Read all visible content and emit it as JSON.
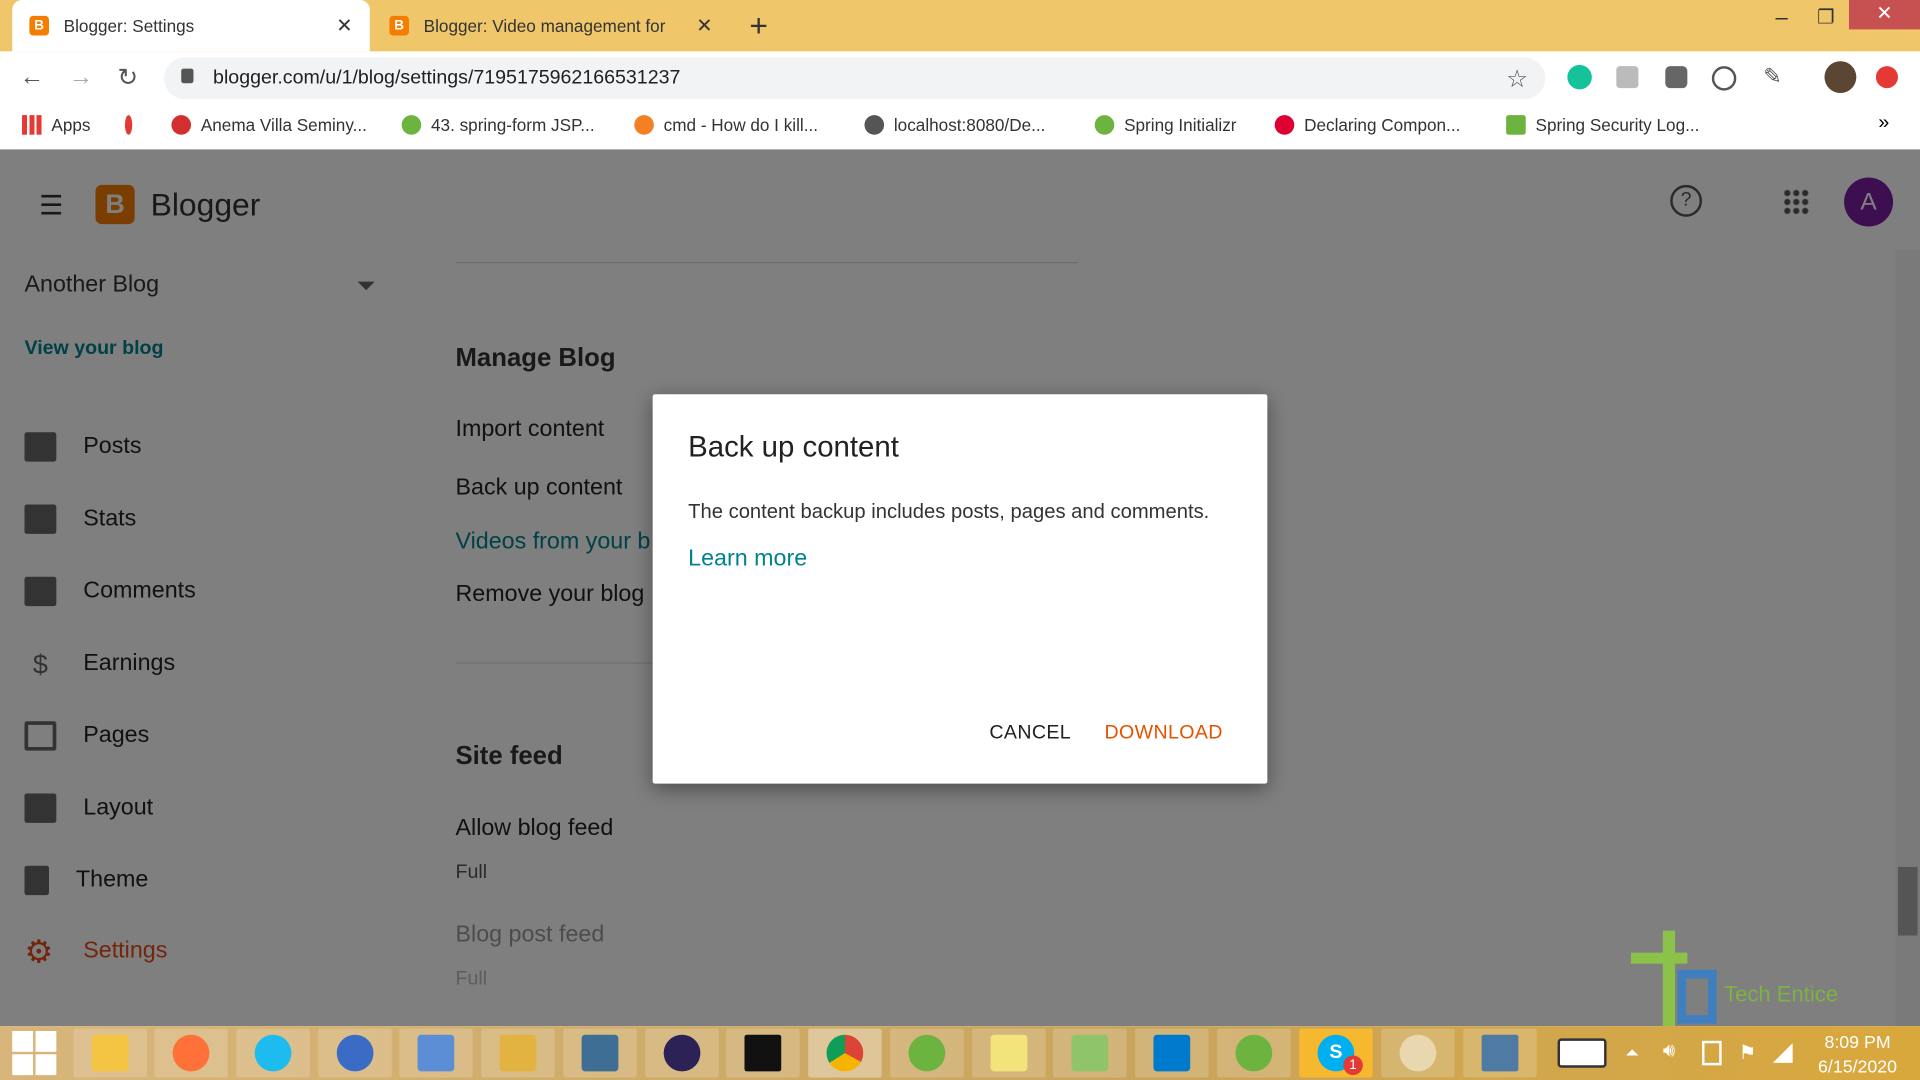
{
  "browser": {
    "tabs": [
      {
        "title": "Blogger: Settings",
        "active": true
      },
      {
        "title": "Blogger: Video management for",
        "active": false
      }
    ],
    "new_tab": "+",
    "url": "blogger.com/u/1/blog/settings/7195175962166531237",
    "bookmarks": [
      "Apps",
      "Anema Villa Seminy...",
      "43. spring-form JSP...",
      "cmd - How do I kill...",
      "localhost:8080/De...",
      "Spring Initializr",
      "Declaring Compon...",
      "Spring Security Log..."
    ],
    "more": "»"
  },
  "app": {
    "name": "Blogger",
    "avatar": "A",
    "help": "?"
  },
  "sidebar": {
    "blog_name": "Another Blog",
    "view_blog": "View your blog",
    "items": [
      {
        "label": "Posts",
        "icon": "posts-icon"
      },
      {
        "label": "Stats",
        "icon": "stats-icon"
      },
      {
        "label": "Comments",
        "icon": "comments-icon"
      },
      {
        "label": "Earnings",
        "icon": "dollar-icon"
      },
      {
        "label": "Pages",
        "icon": "pages-icon"
      },
      {
        "label": "Layout",
        "icon": "layout-icon"
      },
      {
        "label": "Theme",
        "icon": "theme-icon"
      },
      {
        "label": "Settings",
        "icon": "gear-icon",
        "active": true
      }
    ]
  },
  "main": {
    "manage_heading": "Manage Blog",
    "import": "Import content",
    "backup": "Back up content",
    "videos": "Videos from your b",
    "remove": "Remove your blog",
    "feed_heading": "Site feed",
    "allow_feed": "Allow blog feed",
    "allow_feed_value": "Full",
    "post_feed": "Blog post feed",
    "post_feed_value": "Full"
  },
  "dialog": {
    "title": "Back up content",
    "body": "The content backup includes posts, pages and comments.",
    "learn_more": "Learn more",
    "cancel": "CANCEL",
    "download": "DOWNLOAD"
  },
  "watermark": "Tech Entice",
  "taskbar": {
    "time": "8:09 PM",
    "date": "6/15/2020",
    "skype_badge": "1"
  },
  "colors": {
    "accent": "#f57d00",
    "link": "#00838f",
    "download": "#e65100",
    "settings_active": "#e64a19"
  }
}
